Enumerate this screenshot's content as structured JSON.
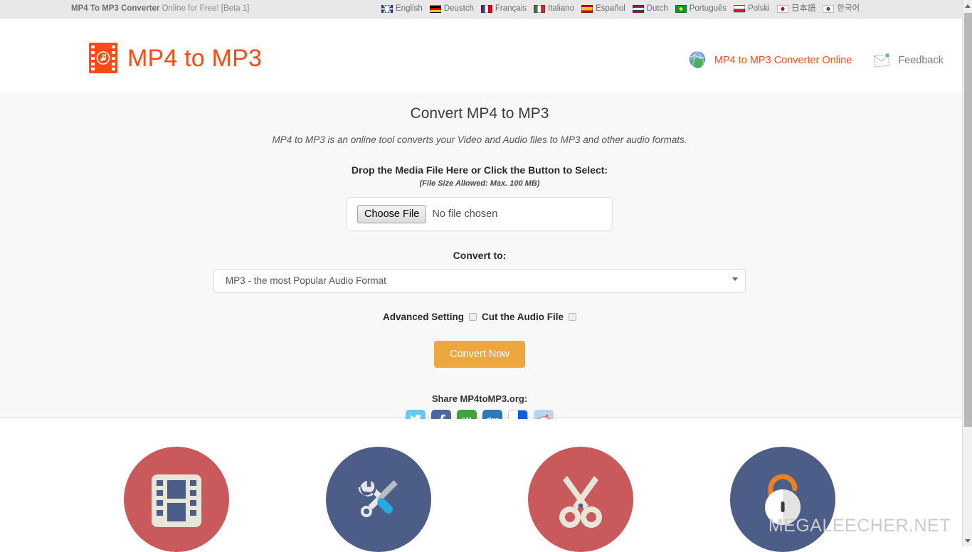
{
  "topbar": {
    "title_bold": "MP4 To MP3 Converter",
    "title_rest": " Online for Free! [Beta 1]",
    "languages": [
      {
        "label": "English",
        "flag": "flag-uk-icon"
      },
      {
        "label": "Deustch",
        "flag": "flag-germany-icon"
      },
      {
        "label": "Français",
        "flag": "flag-france-icon"
      },
      {
        "label": "Italiano",
        "flag": "flag-italy-icon"
      },
      {
        "label": "Español",
        "flag": "flag-spain-icon"
      },
      {
        "label": "Dutch",
        "flag": "flag-netherlands-icon"
      },
      {
        "label": "Português",
        "flag": "flag-brazil-icon"
      },
      {
        "label": "Polski",
        "flag": "flag-poland-icon"
      },
      {
        "label": "日本語",
        "flag": "flag-japan-icon"
      },
      {
        "label": "한국어",
        "flag": "flag-korea-icon"
      }
    ]
  },
  "header": {
    "logo_text": "MP4 to MP3",
    "logo_icon": "film-strip-music-icon",
    "link_converter": "MP4 to MP3 Converter Online",
    "link_converter_icon": "globe-refresh-icon",
    "link_feedback": "Feedback",
    "link_feedback_icon": "envelope-icon"
  },
  "main": {
    "heading": "Convert MP4 to MP3",
    "subheading": "MP4 to MP3 is an online tool converts your Video and Audio files to MP3 and other audio formats.",
    "drop_label": "Drop the Media File Here or Click the Button to Select:",
    "size_note": "(File Size Allowed: Max. 100 MB)",
    "choose_file_label": "Choose File",
    "no_file_text": "No file chosen",
    "convert_to_label": "Convert to:",
    "format_selected": "MP3 - the most Popular Audio Format",
    "advanced_setting_label": "Advanced Setting",
    "cut_audio_label": "Cut the Audio File",
    "convert_button": "Convert Now",
    "share_title": "Share MP4toMP3.org:",
    "share_buttons": [
      {
        "name": "twitter",
        "glyph": "t"
      },
      {
        "name": "facebook",
        "glyph": "f"
      },
      {
        "name": "stumbleupon",
        "glyph": "su"
      },
      {
        "name": "digg",
        "glyph": "digg"
      },
      {
        "name": "delicious",
        "glyph": ""
      },
      {
        "name": "reddit",
        "glyph": ""
      }
    ]
  },
  "features": [
    {
      "name": "video-formats",
      "icon": "film-strip-icon",
      "color": "#c9595b"
    },
    {
      "name": "advanced-settings",
      "icon": "tools-icon",
      "color": "#4c5e87"
    },
    {
      "name": "cut-audio",
      "icon": "scissors-icon",
      "color": "#c9595b"
    },
    {
      "name": "secure-private",
      "icon": "padlock-icon",
      "color": "#4c5e87"
    }
  ],
  "watermark": "MEGALEECHER.NET",
  "colors": {
    "brand_orange": "#ff4a13",
    "button_amber": "#eda73f",
    "feature_red": "#c9595b",
    "feature_blue": "#4c5e87"
  }
}
